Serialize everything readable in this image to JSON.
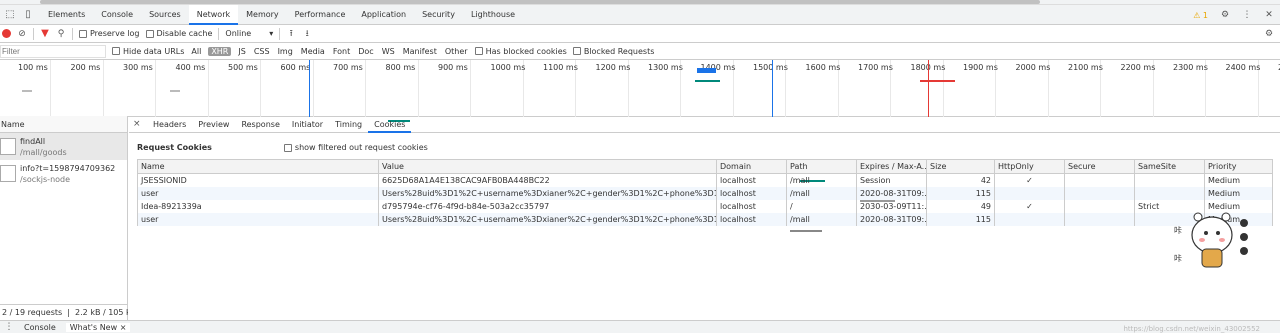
{
  "devtools": {
    "panels": [
      "Elements",
      "Console",
      "Sources",
      "Network",
      "Memory",
      "Performance",
      "Application",
      "Security",
      "Lighthouse"
    ],
    "active_panel": "Network",
    "warning_count": "1"
  },
  "toolbar": {
    "preserve_log": "Preserve log",
    "disable_cache": "Disable cache",
    "throttle": "Online"
  },
  "filterbar": {
    "placeholder": "Filter",
    "hide_data_urls": "Hide data URLs",
    "types": [
      "All",
      "XHR",
      "JS",
      "CSS",
      "Img",
      "Media",
      "Font",
      "Doc",
      "WS",
      "Manifest",
      "Other"
    ],
    "selected_type": "XHR",
    "has_blocked_cookies": "Has blocked cookies",
    "blocked_requests": "Blocked Requests"
  },
  "overview": {
    "ticks": [
      "100 ms",
      "200 ms",
      "300 ms",
      "400 ms",
      "500 ms",
      "600 ms",
      "700 ms",
      "800 ms",
      "900 ms",
      "1000 ms",
      "1100 ms",
      "1200 ms",
      "1300 ms",
      "1400 ms",
      "1500 ms",
      "1600 ms",
      "1700 ms",
      "1800 ms",
      "1900 ms",
      "2000 ms",
      "2100 ms",
      "2200 ms",
      "2300 ms",
      "2400 ms",
      "25"
    ],
    "colors": {
      "dom_content_loaded": "#1a73e8",
      "load": "#e53935",
      "request": "#00897b"
    }
  },
  "requests": {
    "header": "Name",
    "items": [
      {
        "name": "findAll",
        "path": "/mall/goods"
      },
      {
        "name": "info?t=1598794709362",
        "path": "/sockjs-node"
      }
    ],
    "status": "2 / 19 requests",
    "transferred": "2.2 kB / 105 kB t"
  },
  "details": {
    "close": "×",
    "tabs": [
      "Headers",
      "Preview",
      "Response",
      "Initiator",
      "Timing",
      "Cookies"
    ],
    "active_tab": "Cookies",
    "section_title": "Request Cookies",
    "show_filtered": "show filtered out request cookies"
  },
  "cookies": {
    "columns": [
      "Name",
      "Value",
      "Domain",
      "Path",
      "Expires / Max-A...",
      "Size",
      "HttpOnly",
      "Secure",
      "SameSite",
      "Priority"
    ],
    "rows": [
      [
        "JSESSIONID",
        "6625D68A1A4E138CAC9AFB0BA448BC22",
        "localhost",
        "/mall",
        "Session",
        "42",
        "✓",
        "",
        "",
        "Medium"
      ],
      [
        "user",
        "Users%28uid%3D1%2C+username%3Dxianer%2C+gender%3D1%2C+phone%3D18838060...",
        "localhost",
        "/mall",
        "2020-08-31T09:...",
        "115",
        "",
        "",
        "",
        "Medium"
      ],
      [
        "Idea-8921339a",
        "d795794e-cf76-4f9d-b84e-503a2cc35797",
        "localhost",
        "/",
        "2030-03-09T11:...",
        "49",
        "✓",
        "",
        "Strict",
        "Medium"
      ],
      [
        "user",
        "Users%28uid%3D1%2C+username%3Dxianer%2C+gender%3D1%2C+phone%3D18838060...",
        "localhost",
        "/mall",
        "2020-08-31T09:...",
        "115",
        "",
        "",
        "",
        "Medium"
      ]
    ]
  },
  "drawer": {
    "tabs": [
      "Console",
      "What's New"
    ],
    "close": "×"
  },
  "watermark": "https://blog.csdn.net/weixin_43002552"
}
